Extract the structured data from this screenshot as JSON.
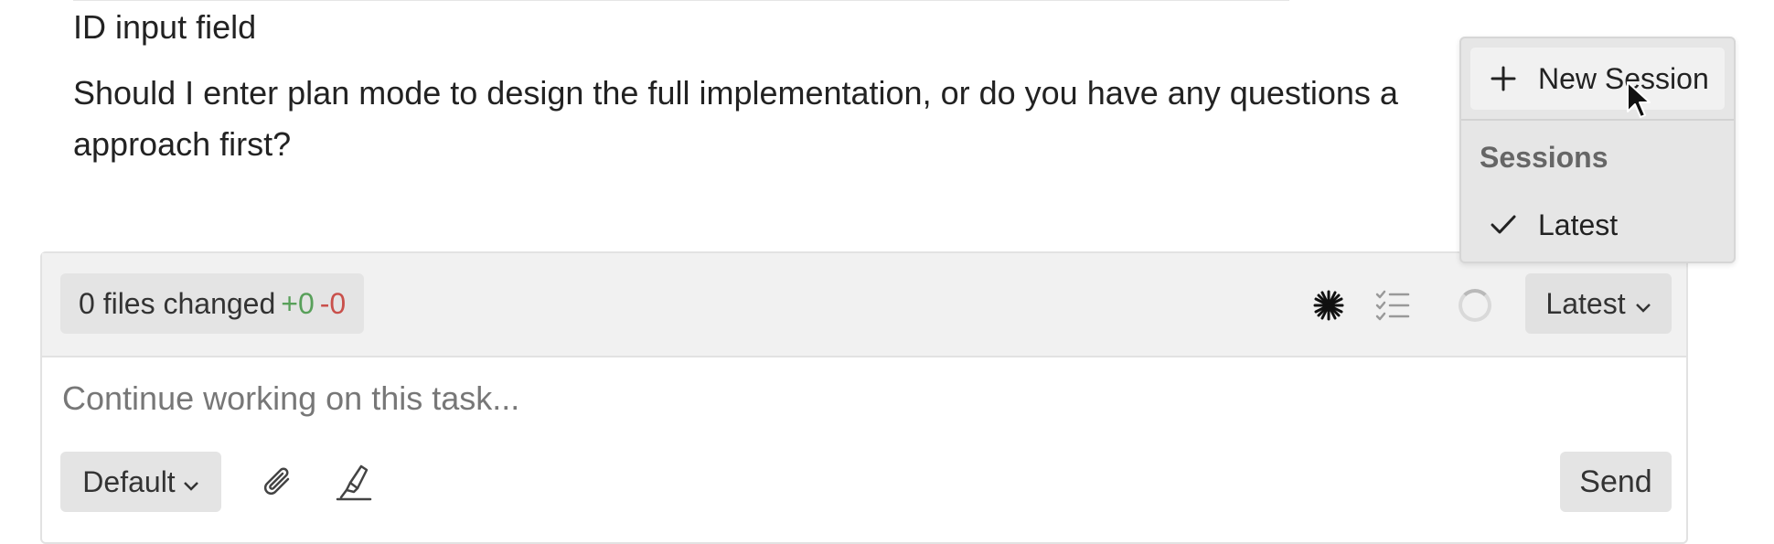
{
  "conversation": {
    "line1": "ID input field",
    "line2": "Should I enter plan mode to design the full implementation, or do you have any questions a",
    "line3": "approach first?"
  },
  "status_bar": {
    "files_changed": "0 files changed",
    "additions": "+0",
    "deletions": "-0",
    "session_label": "Latest",
    "icons": [
      "asterisk-icon",
      "checklist-icon",
      "spinner-icon",
      "chevron-down-icon"
    ]
  },
  "composer": {
    "placeholder": "Continue working on this task...",
    "mode_label": "Default",
    "send_label": "Send",
    "icons": [
      "paperclip-icon",
      "highlighter-icon"
    ]
  },
  "session_menu": {
    "new_session_label": "New Session",
    "section_title": "Sessions",
    "items": [
      {
        "label": "Latest",
        "selected": true
      }
    ]
  },
  "colors": {
    "additions": "#58a05a",
    "deletions": "#c9504b",
    "bar_background": "#f1f1f1",
    "menu_background": "#e6e6e6"
  }
}
